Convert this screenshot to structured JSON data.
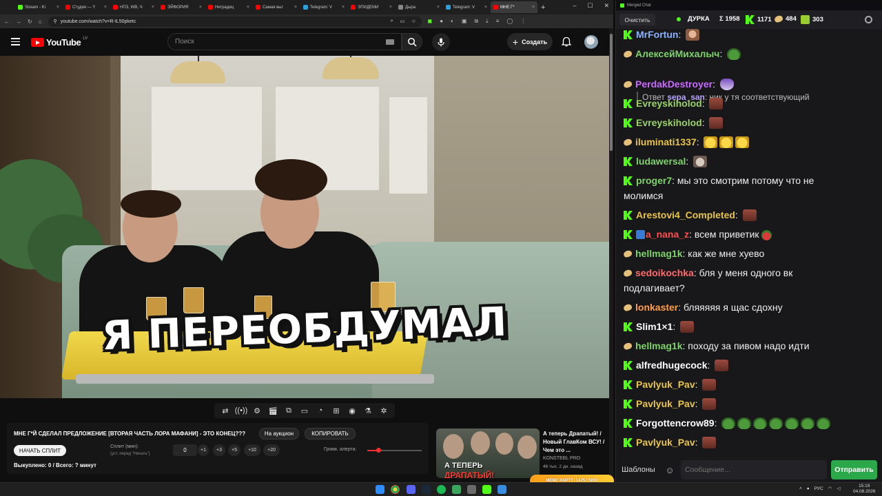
{
  "browser": {
    "tabs": [
      {
        "label": "Stream - Ki",
        "color": "#53fc18",
        "active": false
      },
      {
        "label": "Студия — Y",
        "color": "#ff0000",
        "active": false
      },
      {
        "label": "НПЗ, WB, Ч",
        "color": "#ff0000",
        "active": false
      },
      {
        "label": "ЭЙФОРИЯ",
        "color": "#ff0000",
        "active": false
      },
      {
        "label": "Нетрадиц",
        "color": "#ff0000",
        "active": false
      },
      {
        "label": "Самая выг",
        "color": "#ff0000",
        "active": false
      },
      {
        "label": "Telegram: V",
        "color": "#2aa1da",
        "active": false
      },
      {
        "label": "ЭПИДЕМИ",
        "color": "#ff0000",
        "active": false
      },
      {
        "label": "Дыра",
        "color": "#888888",
        "active": false
      },
      {
        "label": "Telegram: V",
        "color": "#2aa1da",
        "active": false
      },
      {
        "label": "МНЕ Г*",
        "color": "#ff0000",
        "active": true
      }
    ],
    "new_tab": "+",
    "url": "youtube.com/watch?v=R-IL50pketc"
  },
  "youtube": {
    "logo_text": "YouTube",
    "country": "LV",
    "search_placeholder": "Поиск",
    "create_label": "Создать",
    "video_caption": "Я ПЕРЕОБДУМАЛ"
  },
  "extension": {
    "video_title": "МНЕ Г*Й СДЕЛАЛ ПРЕДЛОЖЕНИЕ [ВТОРАЯ ЧАСТЬ ЛОРА МАФАНИ] - ЭТО КОНЕЦ???",
    "auction_label": "На аукцион",
    "copy_label": "КОПИРОВАТЬ",
    "start_split_label": "НАЧАТЬ СПЛИТ",
    "split_label": "Сплит (мин):",
    "split_hint": "(уст. перед \"Начать\")",
    "split_value": "0",
    "steps": [
      "+1",
      "+3",
      "+5",
      "+10",
      "+20"
    ],
    "alert_volume_label": "Громк. алерта:",
    "alert_volume_fraction": 0.2,
    "status": "Выкуплено: 0 / Всего: ? минут"
  },
  "recommendation": {
    "title": "А теперь Драпатый! / Новый ГлавКом ВСУ! / Чем это ...",
    "channel": "KONSTEBL PRO",
    "meta": "46 тыс.   2 дн. назад",
    "thumb_line1": "А ТЕПЕРЬ",
    "thumb_line2": "ДРАПАТЫЙ!"
  },
  "chat": {
    "window_title": "Merged Chat",
    "clear_label": "Очистить",
    "channel_name": "ДУРКА",
    "total_viewers": "Σ 1958",
    "kick_viewers": "1171",
    "twitch_viewers": "484",
    "other_viewers": "303",
    "reply_prefix": "Ответ",
    "reply_user": "sepa_san",
    "reply_text": ": ник у тя соответствующий",
    "messages": [
      {
        "platform": "kick",
        "user": "MrFortun",
        "color": "#8ab4ff",
        "text": "",
        "emotes": [
          "face"
        ]
      },
      {
        "platform": "twitch",
        "user": "АлексейМихалыч",
        "color": "#7fd36b",
        "text": "",
        "emotes": [
          "frog"
        ]
      },
      {
        "platform": "twitch",
        "user": "PerdakDestroyer",
        "color": "#c86bff",
        "text": "",
        "emotes": [
          "bunny"
        ]
      },
      {
        "platform": "kick",
        "user": "Evreyskiholod",
        "color": "#9bd36b",
        "text": "",
        "emotes": [
          "brick"
        ]
      },
      {
        "platform": "kick",
        "user": "Evreyskiholod",
        "color": "#9bd36b",
        "text": "",
        "emotes": [
          "brick"
        ]
      },
      {
        "platform": "twitch",
        "user": "iluminati1337",
        "color": "#e8c54a",
        "text": "",
        "emotes": [
          "yellow",
          "yellow",
          "yellow"
        ]
      },
      {
        "platform": "kick",
        "user": "ludawersal",
        "color": "#7fd36b",
        "text": "",
        "emotes": [
          "cat"
        ]
      },
      {
        "platform": "kick",
        "user": "proger7",
        "color": "#7fd36b",
        "text": "мы это смотрим потому что не молимся",
        "emotes": []
      },
      {
        "platform": "kick",
        "user": "Arestovi4_Completed",
        "color": "#e8c54a",
        "text": "",
        "emotes": [
          "brick"
        ]
      },
      {
        "platform": "kick",
        "user": "a_nana_z",
        "color": "#ff4d4d",
        "text": "всем приветик",
        "emotes": [
          "strawberry"
        ],
        "mod": true
      },
      {
        "platform": "twitch",
        "user": "hellmag1k",
        "color": "#7fd36b",
        "text": "как же мне хуево",
        "emotes": []
      },
      {
        "platform": "twitch",
        "user": "sedoikochka",
        "color": "#ff6b6b",
        "text": "бля у меня одного вк подлагивает?",
        "emotes": []
      },
      {
        "platform": "twitch",
        "user": "lonkaster",
        "color": "#ff9f4d",
        "text": "бляяяяя я щас сдохну",
        "emotes": []
      },
      {
        "platform": "kick",
        "user": "Slim1×1",
        "color": "#ffffff",
        "text": "",
        "emotes": [
          "brick"
        ]
      },
      {
        "platform": "twitch",
        "user": "hellmag1k",
        "color": "#7fd36b",
        "text": "походу за пивом надо идти",
        "emotes": []
      },
      {
        "platform": "kick",
        "user": "alfredhugecock",
        "color": "#ffffff",
        "text": "",
        "emotes": [
          "brick"
        ]
      },
      {
        "platform": "kick",
        "user": "Pavlyuk_Pav",
        "color": "#e8c54a",
        "text": "",
        "emotes": [
          "brick"
        ]
      },
      {
        "platform": "kick",
        "user": "Pavlyuk_Pav",
        "color": "#e8c54a",
        "text": "",
        "emotes": [
          "brick"
        ]
      },
      {
        "platform": "kick",
        "user": "Forgottencrow89",
        "color": "#ffffff",
        "text": "",
        "emotes": [
          "frog",
          "frog",
          "frog",
          "frog",
          "frog",
          "frog",
          "frog"
        ]
      },
      {
        "platform": "kick",
        "user": "Pavlyuk_Pav",
        "color": "#e8c54a",
        "text": "",
        "emotes": [
          "brick"
        ]
      }
    ],
    "templates_label": "Шаблоны",
    "input_placeholder": "Сообщение...",
    "send_label": "Отправить"
  },
  "taskbar": {
    "language": "РУС",
    "time": "15:19",
    "date": "04.08.2026",
    "meme_party_label": "MEME PARTY",
    "meme_party_value": "1475 / 5000"
  }
}
